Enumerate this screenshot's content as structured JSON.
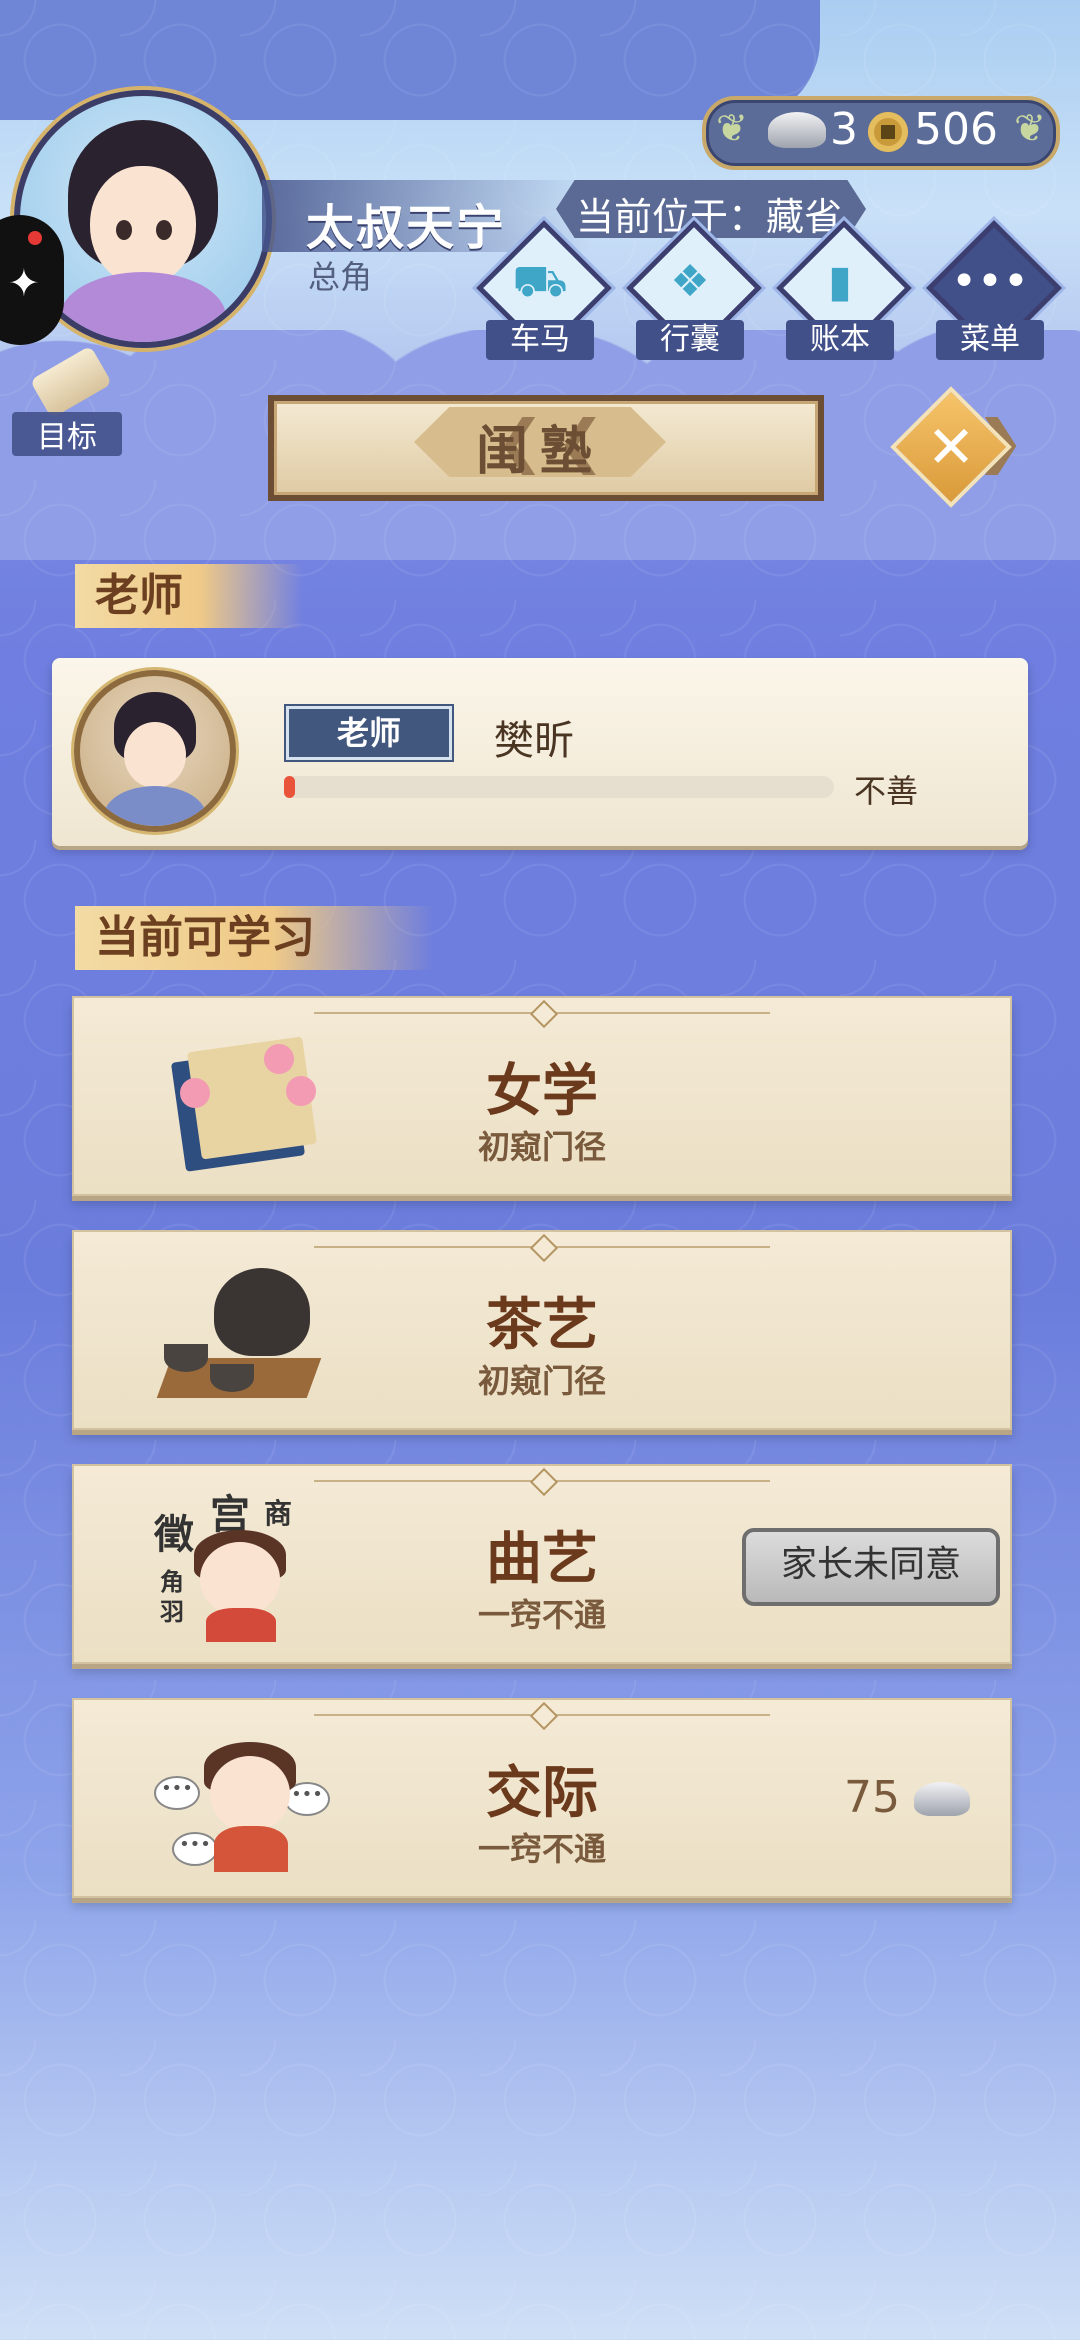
{
  "header": {
    "player_name": "太叔天宁",
    "player_role": "总角",
    "location_text": "当前位于：藏省",
    "currency": {
      "silver": "3",
      "copper": "506"
    },
    "nav": [
      {
        "label": "车马",
        "icon": "carriage-icon"
      },
      {
        "label": "行囊",
        "icon": "bundle-icon"
      },
      {
        "label": "账本",
        "icon": "ledger-icon"
      },
      {
        "label": "菜单",
        "icon": "menu-dots-icon"
      }
    ],
    "goal_label": "目标"
  },
  "banner": {
    "title": "闺塾"
  },
  "teacher_section": {
    "label": "老师",
    "card": {
      "tag": "老师",
      "name": "樊昕",
      "relation_text": "不善",
      "relation_fraction": 0.015
    }
  },
  "courses_section": {
    "label": "当前可学习",
    "courses": [
      {
        "title": "女学",
        "level": "初窥门径",
        "icon": "book-flower-icon"
      },
      {
        "title": "茶艺",
        "level": "初窥门径",
        "icon": "teapot-icon"
      },
      {
        "title": "曲艺",
        "level": "一窍不通",
        "icon": "music-girl-icon",
        "status": "家长未同意",
        "icon_text": [
          "徵",
          "宫",
          "商",
          "角",
          "羽"
        ]
      },
      {
        "title": "交际",
        "level": "一窍不通",
        "icon": "chat-girl-icon",
        "cost": "75"
      }
    ]
  },
  "colors": {
    "accent_gold": "#d99a3a",
    "progress_red": "#e8533a",
    "tag_blue": "#42577e"
  }
}
